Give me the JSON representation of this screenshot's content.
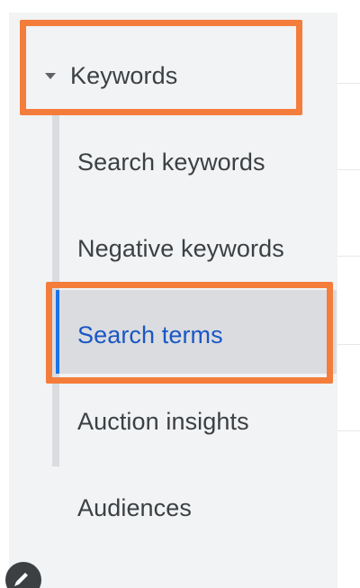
{
  "nav": {
    "parent": {
      "label": "Keywords",
      "expanded": true,
      "icon": "caret-down-icon"
    },
    "children": [
      {
        "label": "Search keywords",
        "selected": false
      },
      {
        "label": "Negative keywords",
        "selected": false
      },
      {
        "label": "Search terms",
        "selected": true
      },
      {
        "label": "Auction insights",
        "selected": false
      }
    ],
    "next_section": {
      "label": "Audiences"
    },
    "bottom_icon": "edit-pencil-icon"
  },
  "colors": {
    "panel_background": "#f1f3f4",
    "selected_background": "#dadce0",
    "selected_text": "#1a56c4",
    "selected_indicator": "#1a73e8",
    "text": "#3c4043",
    "annotation_highlight": "#f47d3b"
  },
  "annotations": [
    {
      "target": "Keywords",
      "style": "orange-outline"
    },
    {
      "target": "Search terms",
      "style": "orange-outline"
    }
  ]
}
